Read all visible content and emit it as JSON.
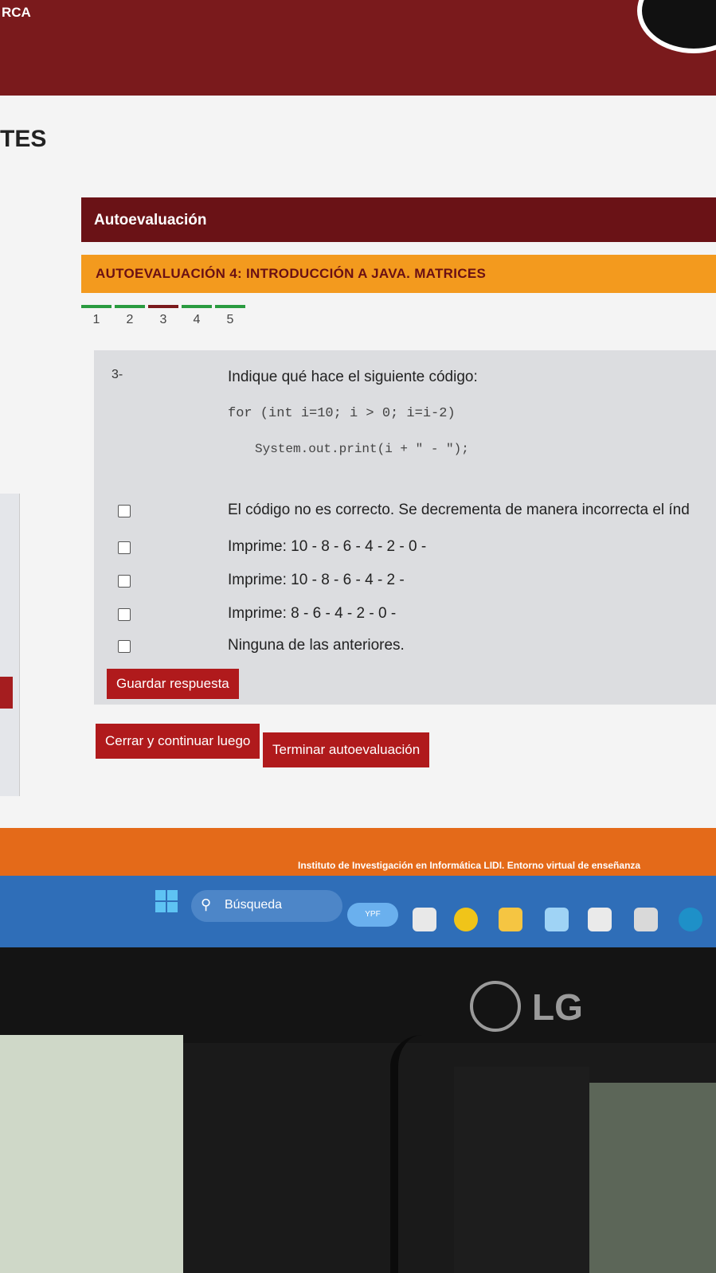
{
  "header": {
    "brand_fragment": "RCA",
    "section_title_fragment": "TES"
  },
  "panel": {
    "title": "Autoevaluación"
  },
  "quiz": {
    "title": "AUTOEVALUACIÓN 4: INTRODUCCIÓN A JAVA. MATRICES"
  },
  "steps": {
    "items": [
      {
        "label": "1",
        "status": "answered"
      },
      {
        "label": "2",
        "status": "answered"
      },
      {
        "label": "3",
        "status": "current"
      },
      {
        "label": "4",
        "status": "answered"
      },
      {
        "label": "5",
        "status": "answered"
      }
    ],
    "colors": {
      "answered": "#2a9b3f",
      "current": "#7a1a1c"
    }
  },
  "question": {
    "number": "3-",
    "text": "Indique qué hace el siguiente código:",
    "code_line1": "for (int i=10; i > 0; i=i-2)",
    "code_line2": "System.out.print(i + \" - \");",
    "options": [
      "El código no es correcto. Se decrementa de manera incorrecta el índ",
      "Imprime:  10 - 8 - 6 - 4 - 2 - 0 -",
      "Imprime:  10 - 8 - 6 - 4 - 2 -",
      "Imprime:  8 - 6 - 4 - 2 - 0 -",
      "Ninguna de las anteriores."
    ]
  },
  "buttons": {
    "save": "Guardar respuesta",
    "close_continue": "Cerrar y continuar luego",
    "finish": "Terminar autoevaluación"
  },
  "footer": {
    "text": "Instituto de Investigación en Informática LIDI. Entorno virtual de enseñanza"
  },
  "taskbar": {
    "search_label": "Búsqueda",
    "chip_text": "YPF"
  },
  "monitor": {
    "brand": "LG"
  },
  "colors": {
    "brand_dark": "#6a1216",
    "accent_orange": "#f39a1e",
    "button_red": "#b01a1c"
  }
}
